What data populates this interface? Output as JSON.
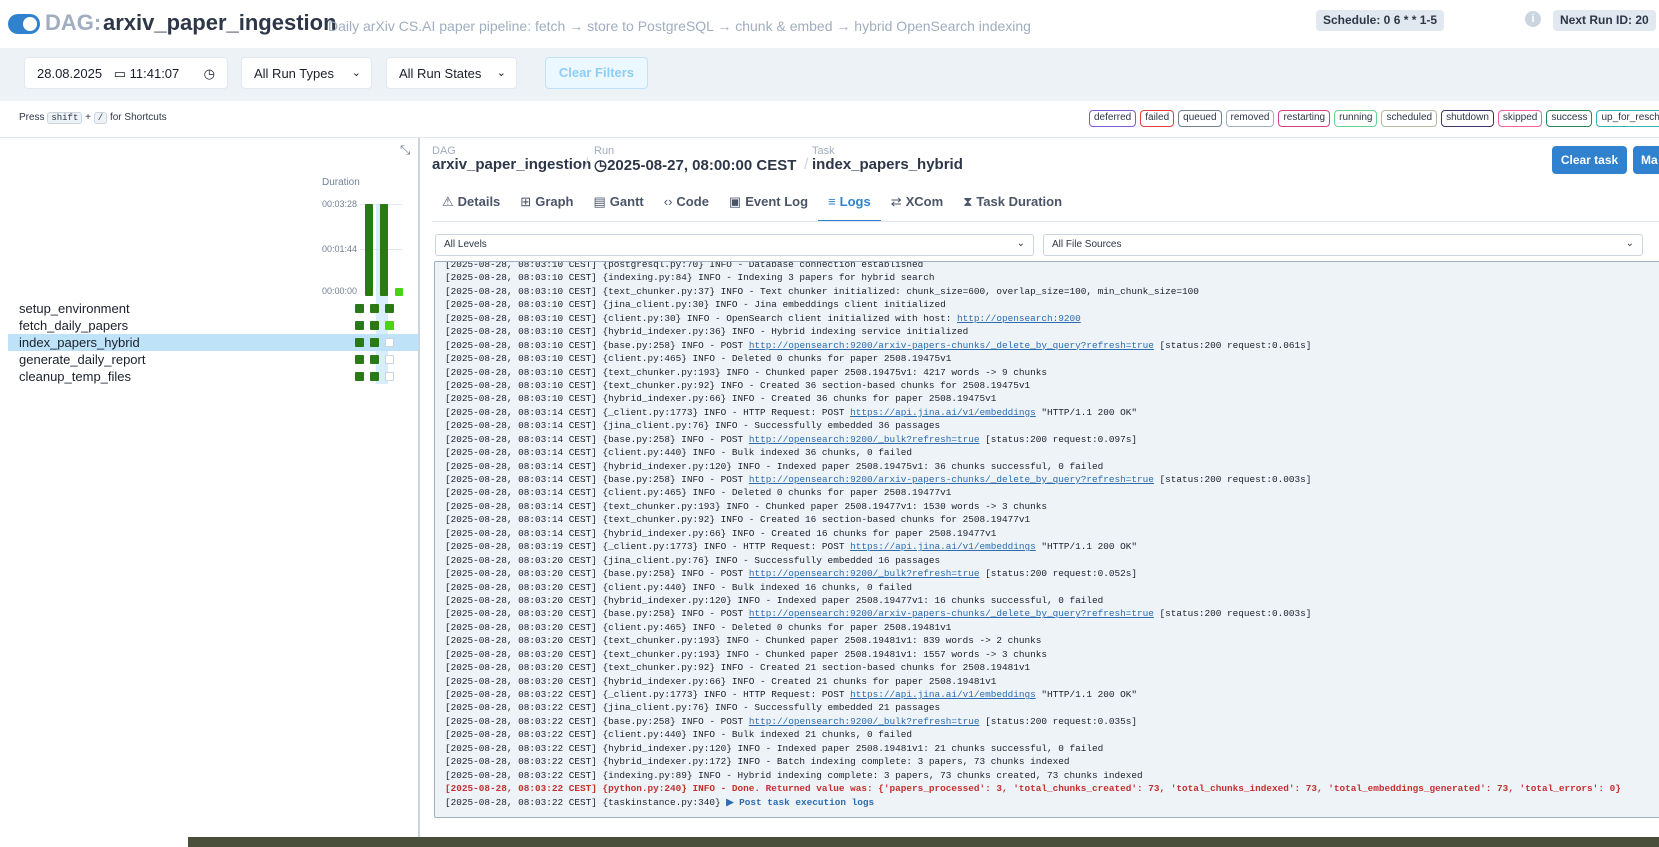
{
  "header": {
    "dag_prefix": "DAG:",
    "dag_name": "arxiv_paper_ingestion",
    "description": "Daily arXiv CS.AI paper pipeline: fetch → store to PostgreSQL → chunk & embed → hybrid OpenSearch indexing",
    "schedule": "Schedule: 0 6 * * 1-5",
    "next_run": "Next Run ID: 20"
  },
  "filters": {
    "datetime": "28.08.2025",
    "time": "11:41:07",
    "run_types": "All Run Types",
    "run_states": "All Run States",
    "clear_filters": "Clear Filters"
  },
  "shortcut": {
    "press": "Press",
    "key1": "shift",
    "plus": "+",
    "key2": "/",
    "suffix": "for Shortcuts"
  },
  "states": [
    {
      "label": "deferred",
      "color": "#805ad5"
    },
    {
      "label": "failed",
      "color": "#e53e3e"
    },
    {
      "label": "queued",
      "color": "#718096"
    },
    {
      "label": "removed",
      "color": "#a0aec0"
    },
    {
      "label": "restarting",
      "color": "#d53f8c"
    },
    {
      "label": "running",
      "color": "#68d391"
    },
    {
      "label": "scheduled",
      "color": "#b7b7a4"
    },
    {
      "label": "shutdown",
      "color": "#3c366b"
    },
    {
      "label": "skipped",
      "color": "#ed64a6"
    },
    {
      "label": "success",
      "color": "#2f855a"
    },
    {
      "label": "up_for_resched",
      "color": "#38b2ac"
    }
  ],
  "grid": {
    "duration_label": "Duration",
    "ticks": [
      "00:03:28",
      "00:01:44",
      "00:00:00"
    ],
    "tasks": [
      {
        "name": "setup_environment",
        "cells": [
          "#2a7a14",
          "#2a7a14",
          "#2a7a14"
        ]
      },
      {
        "name": "fetch_daily_papers",
        "cells": [
          "#2a7a14",
          "#2a7a14",
          "#4ad315"
        ]
      },
      {
        "name": "index_papers_hybrid",
        "cells": [
          "#2a7a14",
          "#2a7a14",
          "#ffffff"
        ]
      },
      {
        "name": "generate_daily_report",
        "cells": [
          "#2a7a14",
          "#2a7a14",
          "#ffffff"
        ]
      },
      {
        "name": "cleanup_temp_files",
        "cells": [
          "#2a7a14",
          "#2a7a14",
          "#ffffff"
        ]
      }
    ],
    "bar_fractions": [
      1.0,
      1.0,
      0.05
    ]
  },
  "breadcrumb": {
    "dag_label": "DAG",
    "dag_value": "arxiv_paper_ingestion",
    "run_label": "Run",
    "run_value": "2025-08-27, 08:00:00 CEST",
    "task_label": "Task",
    "task_value": "index_papers_hybrid"
  },
  "actions": {
    "clear_task": "Clear task",
    "mark": "Ma"
  },
  "tabs": [
    {
      "icon": "⚠",
      "label": "Details"
    },
    {
      "icon": "⊞",
      "label": "Graph"
    },
    {
      "icon": "▤",
      "label": "Gantt"
    },
    {
      "icon": "‹›",
      "label": "Code"
    },
    {
      "icon": "▣",
      "label": "Event Log"
    },
    {
      "icon": "≡",
      "label": "Logs"
    },
    {
      "icon": "⇄",
      "label": "XCom"
    },
    {
      "icon": "⧗",
      "label": "Task Duration"
    }
  ],
  "log_filters": {
    "levels": "All Levels",
    "sources": "All File Sources"
  },
  "logs": [
    {
      "t": "[2025-08-28, 08:03:10 CEST] {postgresql.py:70} INFO - Database connection established"
    },
    {
      "t": "[2025-08-28, 08:03:10 CEST] {indexing.py:84} INFO - Indexing 3 papers for hybrid search"
    },
    {
      "t": "[2025-08-28, 08:03:10 CEST] {text_chunker.py:37} INFO - Text chunker initialized: chunk_size=600, overlap_size=100, min_chunk_size=100"
    },
    {
      "t": "[2025-08-28, 08:03:10 CEST] {jina_client.py:30} INFO - Jina embeddings client initialized"
    },
    {
      "t": "[2025-08-28, 08:03:10 CEST] {client.py:30} INFO - OpenSearch client initialized with host: ",
      "link": "http://opensearch:9200",
      "after": ""
    },
    {
      "t": "[2025-08-28, 08:03:10 CEST] {hybrid_indexer.py:36} INFO - Hybrid indexing service initialized"
    },
    {
      "t": "[2025-08-28, 08:03:10 CEST] {base.py:258} INFO - POST ",
      "link": "http://opensearch:9200/arxiv-papers-chunks/_delete_by_query?refresh=true",
      "after": " [status:200 request:0.061s]"
    },
    {
      "t": "[2025-08-28, 08:03:10 CEST] {client.py:465} INFO - Deleted 0 chunks for paper 2508.19475v1"
    },
    {
      "t": "[2025-08-28, 08:03:10 CEST] {text_chunker.py:193} INFO - Chunked paper 2508.19475v1: 4217 words -> 9 chunks"
    },
    {
      "t": "[2025-08-28, 08:03:10 CEST] {text_chunker.py:92} INFO - Created 36 section-based chunks for 2508.19475v1"
    },
    {
      "t": "[2025-08-28, 08:03:10 CEST] {hybrid_indexer.py:66} INFO - Created 36 chunks for paper 2508.19475v1"
    },
    {
      "t": "[2025-08-28, 08:03:14 CEST] {_client.py:1773} INFO - HTTP Request: POST ",
      "link": "https://api.jina.ai/v1/embeddings",
      "after": " \"HTTP/1.1 200 OK\""
    },
    {
      "t": "[2025-08-28, 08:03:14 CEST] {jina_client.py:76} INFO - Successfully embedded 36 passages"
    },
    {
      "t": "[2025-08-28, 08:03:14 CEST] {base.py:258} INFO - POST ",
      "link": "http://opensearch:9200/_bulk?refresh=true",
      "after": " [status:200 request:0.097s]"
    },
    {
      "t": "[2025-08-28, 08:03:14 CEST] {client.py:440} INFO - Bulk indexed 36 chunks, 0 failed"
    },
    {
      "t": "[2025-08-28, 08:03:14 CEST] {hybrid_indexer.py:120} INFO - Indexed paper 2508.19475v1: 36 chunks successful, 0 failed"
    },
    {
      "t": "[2025-08-28, 08:03:14 CEST] {base.py:258} INFO - POST ",
      "link": "http://opensearch:9200/arxiv-papers-chunks/_delete_by_query?refresh=true",
      "after": " [status:200 request:0.003s]"
    },
    {
      "t": "[2025-08-28, 08:03:14 CEST] {client.py:465} INFO - Deleted 0 chunks for paper 2508.19477v1"
    },
    {
      "t": "[2025-08-28, 08:03:14 CEST] {text_chunker.py:193} INFO - Chunked paper 2508.19477v1: 1530 words -> 3 chunks"
    },
    {
      "t": "[2025-08-28, 08:03:14 CEST] {text_chunker.py:92} INFO - Created 16 section-based chunks for 2508.19477v1"
    },
    {
      "t": "[2025-08-28, 08:03:14 CEST] {hybrid_indexer.py:66} INFO - Created 16 chunks for paper 2508.19477v1"
    },
    {
      "t": "[2025-08-28, 08:03:19 CEST] {_client.py:1773} INFO - HTTP Request: POST ",
      "link": "https://api.jina.ai/v1/embeddings",
      "after": " \"HTTP/1.1 200 OK\""
    },
    {
      "t": "[2025-08-28, 08:03:20 CEST] {jina_client.py:76} INFO - Successfully embedded 16 passages"
    },
    {
      "t": "[2025-08-28, 08:03:20 CEST] {base.py:258} INFO - POST ",
      "link": "http://opensearch:9200/_bulk?refresh=true",
      "after": " [status:200 request:0.052s]"
    },
    {
      "t": "[2025-08-28, 08:03:20 CEST] {client.py:440} INFO - Bulk indexed 16 chunks, 0 failed"
    },
    {
      "t": "[2025-08-28, 08:03:20 CEST] {hybrid_indexer.py:120} INFO - Indexed paper 2508.19477v1: 16 chunks successful, 0 failed"
    },
    {
      "t": "[2025-08-28, 08:03:20 CEST] {base.py:258} INFO - POST ",
      "link": "http://opensearch:9200/arxiv-papers-chunks/_delete_by_query?refresh=true",
      "after": " [status:200 request:0.003s]"
    },
    {
      "t": "[2025-08-28, 08:03:20 CEST] {client.py:465} INFO - Deleted 0 chunks for paper 2508.19481v1"
    },
    {
      "t": "[2025-08-28, 08:03:20 CEST] {text_chunker.py:193} INFO - Chunked paper 2508.19481v1: 839 words -> 2 chunks"
    },
    {
      "t": "[2025-08-28, 08:03:20 CEST] {text_chunker.py:193} INFO - Chunked paper 2508.19481v1: 1557 words -> 3 chunks"
    },
    {
      "t": "[2025-08-28, 08:03:20 CEST] {text_chunker.py:92} INFO - Created 21 section-based chunks for 2508.19481v1"
    },
    {
      "t": "[2025-08-28, 08:03:20 CEST] {hybrid_indexer.py:66} INFO - Created 21 chunks for paper 2508.19481v1"
    },
    {
      "t": "[2025-08-28, 08:03:22 CEST] {_client.py:1773} INFO - HTTP Request: POST ",
      "link": "https://api.jina.ai/v1/embeddings",
      "after": " \"HTTP/1.1 200 OK\""
    },
    {
      "t": "[2025-08-28, 08:03:22 CEST] {jina_client.py:76} INFO - Successfully embedded 21 passages"
    },
    {
      "t": "[2025-08-28, 08:03:22 CEST] {base.py:258} INFO - POST ",
      "link": "http://opensearch:9200/_bulk?refresh=true",
      "after": " [status:200 request:0.035s]"
    },
    {
      "t": "[2025-08-28, 08:03:22 CEST] {client.py:440} INFO - Bulk indexed 21 chunks, 0 failed"
    },
    {
      "t": "[2025-08-28, 08:03:22 CEST] {hybrid_indexer.py:120} INFO - Indexed paper 2508.19481v1: 21 chunks successful, 0 failed"
    },
    {
      "t": "[2025-08-28, 08:03:22 CEST] {hybrid_indexer.py:172} INFO - Batch indexing complete: 3 papers, 73 chunks indexed"
    },
    {
      "t": "[2025-08-28, 08:03:22 CEST] {indexing.py:89} INFO - Hybrid indexing complete: 3 papers, 73 chunks created, 73 chunks indexed"
    },
    {
      "t": "[2025-08-28, 08:03:22 CEST] {python.py:240} INFO - Done. Returned value was: {'papers_processed': 3, 'total_chunks_created': 73, 'total_chunks_indexed': 73, 'total_embeddings_generated': 73, 'total_errors': 0}",
      "error": true
    },
    {
      "t": "[2025-08-28, 08:03:22 CEST] {taskinstance.py:340} ",
      "post": "▶ Post task execution logs"
    }
  ]
}
